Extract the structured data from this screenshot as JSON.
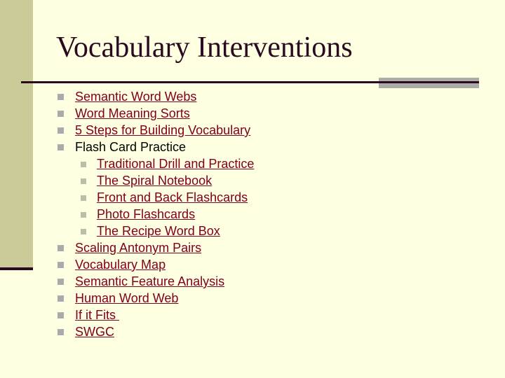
{
  "slide": {
    "title": "Vocabulary Interventions",
    "colors": {
      "background": "#FFFFE1",
      "sidebar": "#CBCB9A",
      "accent_dark": "#2A0A20",
      "link": "#800020",
      "bullet": "#ABABAB"
    },
    "items": [
      {
        "label": "Semantic Word Webs",
        "link": true,
        "level": 1
      },
      {
        "label": "Word Meaning Sorts",
        "link": true,
        "level": 1
      },
      {
        "label": "5 Steps for Building Vocabulary",
        "link": true,
        "level": 1
      },
      {
        "label": "Flash Card Practice",
        "link": false,
        "level": 1
      },
      {
        "label": "Traditional Drill and Practice",
        "link": true,
        "level": 2
      },
      {
        "label": "The Spiral Notebook",
        "link": true,
        "level": 2
      },
      {
        "label": "Front and Back Flashcards",
        "link": true,
        "level": 2
      },
      {
        "label": "Photo Flashcards",
        "link": true,
        "level": 2
      },
      {
        "label": "The Recipe Word Box",
        "link": true,
        "level": 2
      },
      {
        "label": "Scaling Antonym Pairs",
        "link": true,
        "level": 1
      },
      {
        "label": "Vocabulary Map",
        "link": true,
        "level": 1
      },
      {
        "label": "Semantic Feature Analysis",
        "link": true,
        "level": 1
      },
      {
        "label": "Human Word Web",
        "link": true,
        "level": 1
      },
      {
        "label": "If it Fits ",
        "link": true,
        "level": 1
      },
      {
        "label": "SWGC",
        "link": true,
        "level": 1
      }
    ]
  }
}
